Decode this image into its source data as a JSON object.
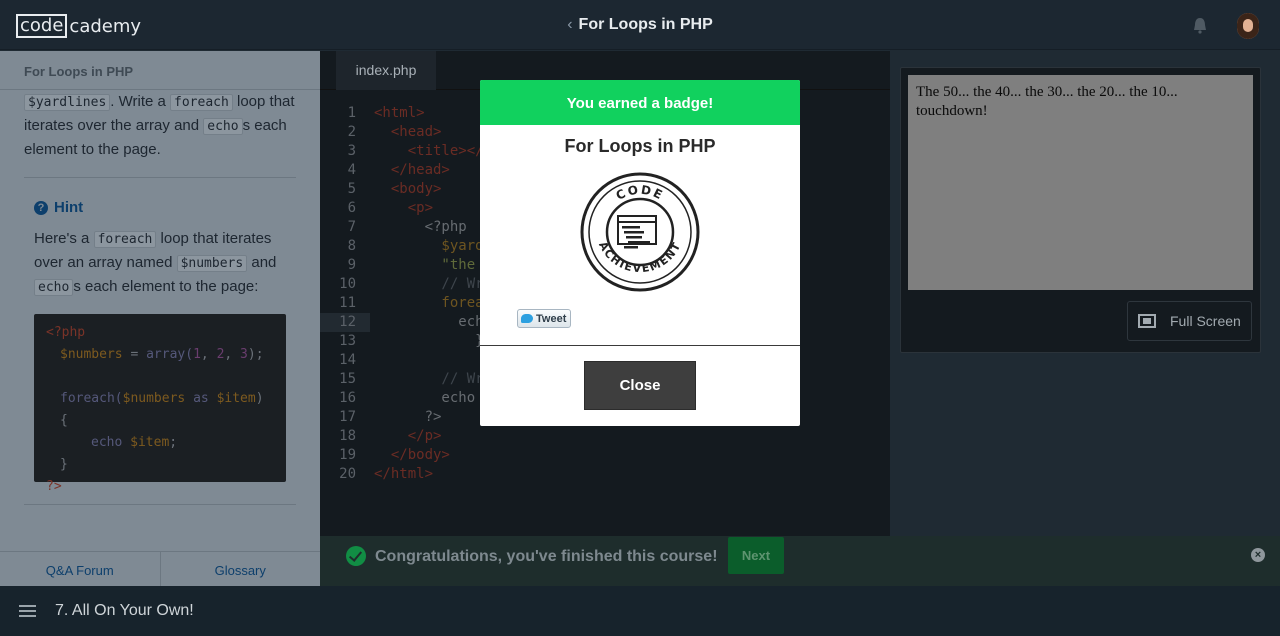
{
  "app": {
    "logo_box": "code",
    "logo_rest": "cademy",
    "course_title": "For Loops in PHP"
  },
  "left_panel": {
    "header": "For Loops in PHP",
    "instruction": {
      "code1": "$yardlines",
      "text1": ". Write a ",
      "code2": "foreach",
      "text2": " loop that iterates over the array and ",
      "code3": "echo",
      "text3": "s each element to the page."
    },
    "hint": {
      "label": "Hint",
      "text1": "Here's a ",
      "code1": "foreach",
      "text2": " loop that iterates over an array named ",
      "code2": "$numbers",
      "text3": " and ",
      "code3": "echo",
      "text4": "s each element to the page:"
    },
    "code_sample": {
      "l1": "<?php",
      "l2_var": "$numbers",
      "l2_eq": " = ",
      "l2_fn": "array(",
      "l2_n1": "1",
      "l2_c1": ", ",
      "l2_n2": "2",
      "l2_c2": ", ",
      "l2_n3": "3",
      "l2_end": ");",
      "l4_kw": "foreach(",
      "l4_var1": "$numbers",
      "l4_as": " as ",
      "l4_var2": "$item",
      "l4_end": ") {",
      "l5_kw": "echo ",
      "l5_var": "$item",
      "l5_end": ";",
      "l6": "}",
      "l7": "?>"
    },
    "links": {
      "qa": "Q&A Forum",
      "glossary": "Glossary"
    }
  },
  "editor": {
    "tab": "index.php",
    "lines": [
      {
        "n": "1",
        "parts": [
          [
            "tag",
            "<html>"
          ]
        ]
      },
      {
        "n": "2",
        "parts": [
          [
            "tag",
            "  <head>"
          ]
        ]
      },
      {
        "n": "3",
        "parts": [
          [
            "tag",
            "    <title></"
          ]
        ]
      },
      {
        "n": "4",
        "parts": [
          [
            "tag",
            "  </head>"
          ]
        ]
      },
      {
        "n": "5",
        "parts": [
          [
            "tag",
            "  <body>"
          ]
        ]
      },
      {
        "n": "6",
        "parts": [
          [
            "tag",
            "    <p>"
          ]
        ]
      },
      {
        "n": "7",
        "parts": [
          [
            "",
            "      <?php"
          ]
        ]
      },
      {
        "n": "8",
        "parts": [
          [
            "var",
            "        $yard"
          ],
          [
            "",
            "                             \","
          ]
        ]
      },
      {
        "n": "9",
        "parts": [
          [
            "str",
            "        \"the "
          ]
        ]
      },
      {
        "n": "10",
        "parts": [
          [
            "cm",
            "        // Wr"
          ]
        ]
      },
      {
        "n": "11",
        "parts": [
          [
            "var",
            "        forea"
          ]
        ]
      },
      {
        "n": "12",
        "parts": [
          [
            "",
            "          echo"
          ]
        ]
      },
      {
        "n": "13",
        "parts": [
          [
            "",
            "            }"
          ]
        ]
      },
      {
        "n": "14",
        "parts": [
          [
            "",
            ""
          ]
        ]
      },
      {
        "n": "15",
        "parts": [
          [
            "cm",
            "        // Wr"
          ]
        ]
      },
      {
        "n": "16",
        "parts": [
          [
            "",
            "        echo "
          ]
        ]
      },
      {
        "n": "17",
        "parts": [
          [
            "",
            "      ?>"
          ]
        ]
      },
      {
        "n": "18",
        "parts": [
          [
            "tag",
            "    </p>"
          ]
        ]
      },
      {
        "n": "19",
        "parts": [
          [
            "tag",
            "  </body>"
          ]
        ]
      },
      {
        "n": "20",
        "parts": [
          [
            "tag",
            "</html>"
          ]
        ]
      }
    ]
  },
  "output": {
    "text": "The 50... the 40... the 30... the 20... the 10... touchdown!",
    "fullscreen_label": "Full Screen"
  },
  "status_bar": {
    "message": "Congratulations, you've finished this course!",
    "next_label": "Next",
    "close_symbol": "×"
  },
  "footer": {
    "lesson": "7. All On Your Own!"
  },
  "modal": {
    "header": "You earned a badge!",
    "title": "For Loops in PHP",
    "badge_top": "CODE",
    "badge_bottom": "ACHIEVEMENT",
    "tweet_label": "Tweet",
    "close_label": "Close"
  },
  "colors": {
    "accent_green": "#11d15e",
    "status_green": "#118d44",
    "link_blue": "#0d3f6c"
  }
}
